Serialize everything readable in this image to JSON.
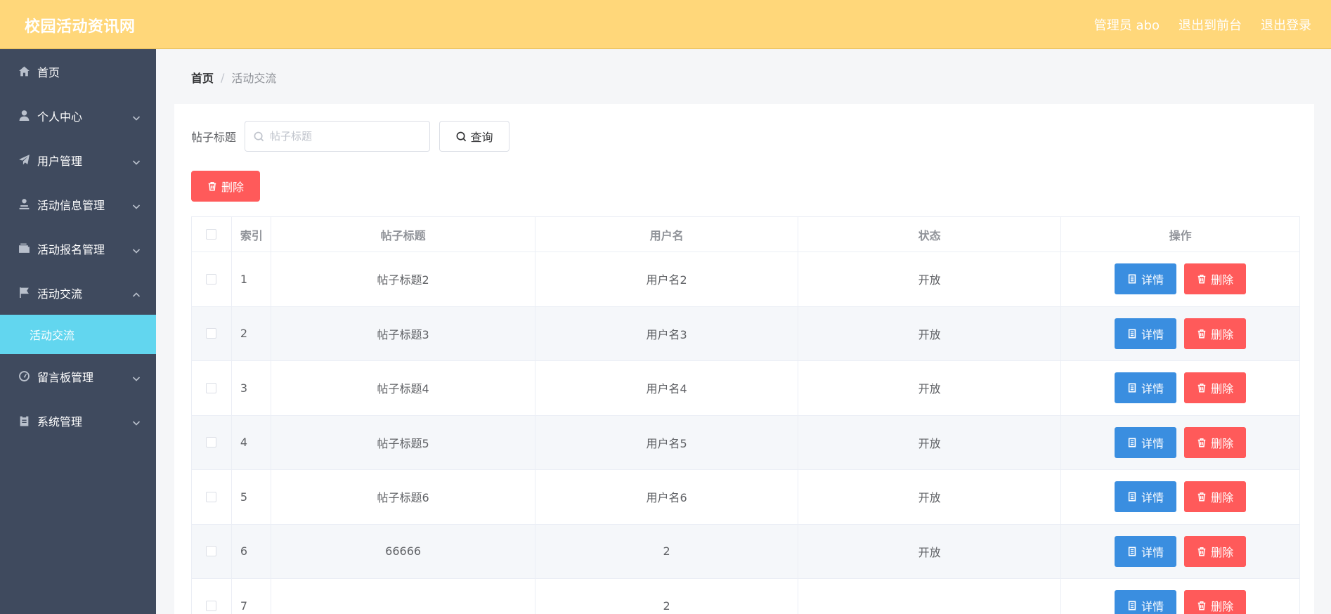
{
  "header": {
    "brand": "校园活动资讯网",
    "links": [
      "管理员 abo",
      "退出到前台",
      "退出登录"
    ]
  },
  "sidebar": {
    "items": [
      {
        "label": "首页",
        "icon": "home-icon",
        "expandable": false
      },
      {
        "label": "个人中心",
        "icon": "user-icon",
        "expandable": true
      },
      {
        "label": "用户管理",
        "icon": "send-icon",
        "expandable": true
      },
      {
        "label": "活动信息管理",
        "icon": "person-icon",
        "expandable": true
      },
      {
        "label": "活动报名管理",
        "icon": "wallet-icon",
        "expandable": true
      },
      {
        "label": "活动交流",
        "icon": "flag-icon",
        "expandable": true,
        "open": true
      }
    ],
    "sub_item": "活动交流",
    "items_after": [
      {
        "label": "留言板管理",
        "icon": "gauge-icon",
        "expandable": true
      },
      {
        "label": "系统管理",
        "icon": "clipboard-icon",
        "expandable": true
      }
    ]
  },
  "breadcrumb": {
    "home": "首页",
    "separator": "/",
    "current": "活动交流"
  },
  "search": {
    "label": "帖子标题",
    "placeholder": "帖子标题",
    "value": "",
    "button": "查询"
  },
  "toolbar": {
    "delete": "删除"
  },
  "table": {
    "columns": [
      "索引",
      "帖子标题",
      "用户名",
      "状态",
      "操作"
    ],
    "rows": [
      {
        "index": "1",
        "title": "帖子标题2",
        "user": "用户名2",
        "status": "开放"
      },
      {
        "index": "2",
        "title": "帖子标题3",
        "user": "用户名3",
        "status": "开放"
      },
      {
        "index": "3",
        "title": "帖子标题4",
        "user": "用户名4",
        "status": "开放"
      },
      {
        "index": "4",
        "title": "帖子标题5",
        "user": "用户名5",
        "status": "开放"
      },
      {
        "index": "5",
        "title": "帖子标题6",
        "user": "用户名6",
        "status": "开放"
      },
      {
        "index": "6",
        "title": "66666",
        "user": "2",
        "status": "开放"
      },
      {
        "index": "7",
        "title": "",
        "user": "2",
        "status": ""
      }
    ],
    "actions": {
      "detail": "详情",
      "delete": "删除"
    }
  },
  "colors": {
    "header": "#ffd77a",
    "sidebar": "#3f4a5e",
    "active_sub": "#62d6ef",
    "detail_btn": "#3a8ee0",
    "danger_btn": "#ff5a5a"
  }
}
